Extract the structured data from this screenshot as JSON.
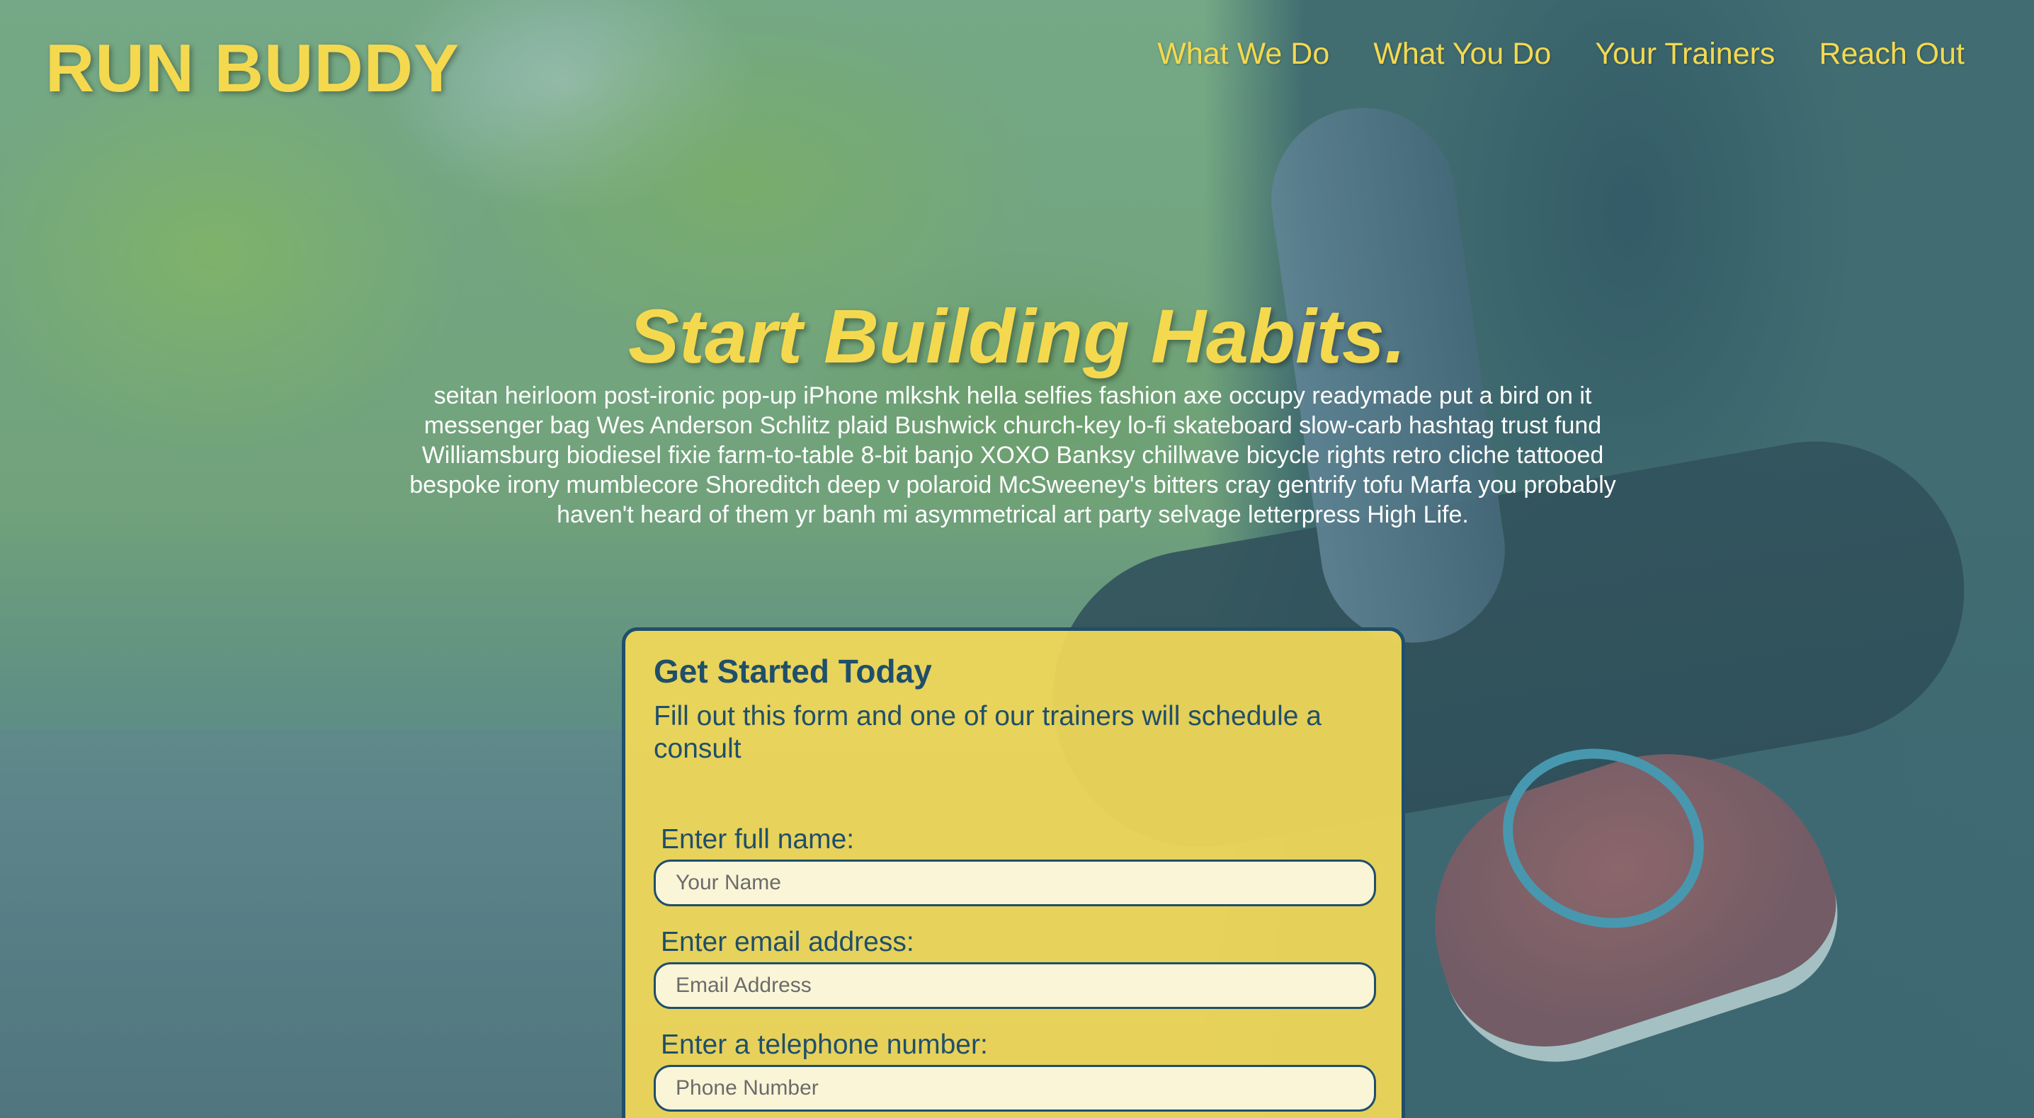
{
  "header": {
    "logo": "RUN BUDDY",
    "nav": [
      "What We Do",
      "What You Do",
      "Your Trainers",
      "Reach Out"
    ]
  },
  "hero": {
    "headline": "Start Building Habits.",
    "intro": "seitan heirloom post-ironic pop-up iPhone mlkshk hella selfies fashion axe occupy readymade put a bird on it messenger bag Wes Anderson Schlitz plaid Bushwick church-key lo-fi skateboard slow-carb hashtag trust fund Williamsburg biodiesel fixie farm-to-table 8-bit banjo XOXO Banksy chillwave bicycle rights retro cliche tattooed bespoke irony mumblecore Shoreditch deep v polaroid McSweeney's bitters cray gentrify tofu Marfa you probably haven't heard of them yr banh mi asymmetrical art party selvage letterpress High Life."
  },
  "form": {
    "title": "Get Started Today",
    "subtitle": "Fill out this form and one of our trainers will schedule a consult",
    "fields": [
      {
        "label": "Enter full name:",
        "placeholder": "Your Name",
        "value": ""
      },
      {
        "label": "Enter email address:",
        "placeholder": "Email Address",
        "value": ""
      },
      {
        "label": "Enter a telephone number:",
        "placeholder": "Phone Number",
        "value": ""
      }
    ]
  },
  "colors": {
    "accent": "#f4d94f",
    "form_background": "#f2d858",
    "form_text": "#1f4f6a"
  }
}
